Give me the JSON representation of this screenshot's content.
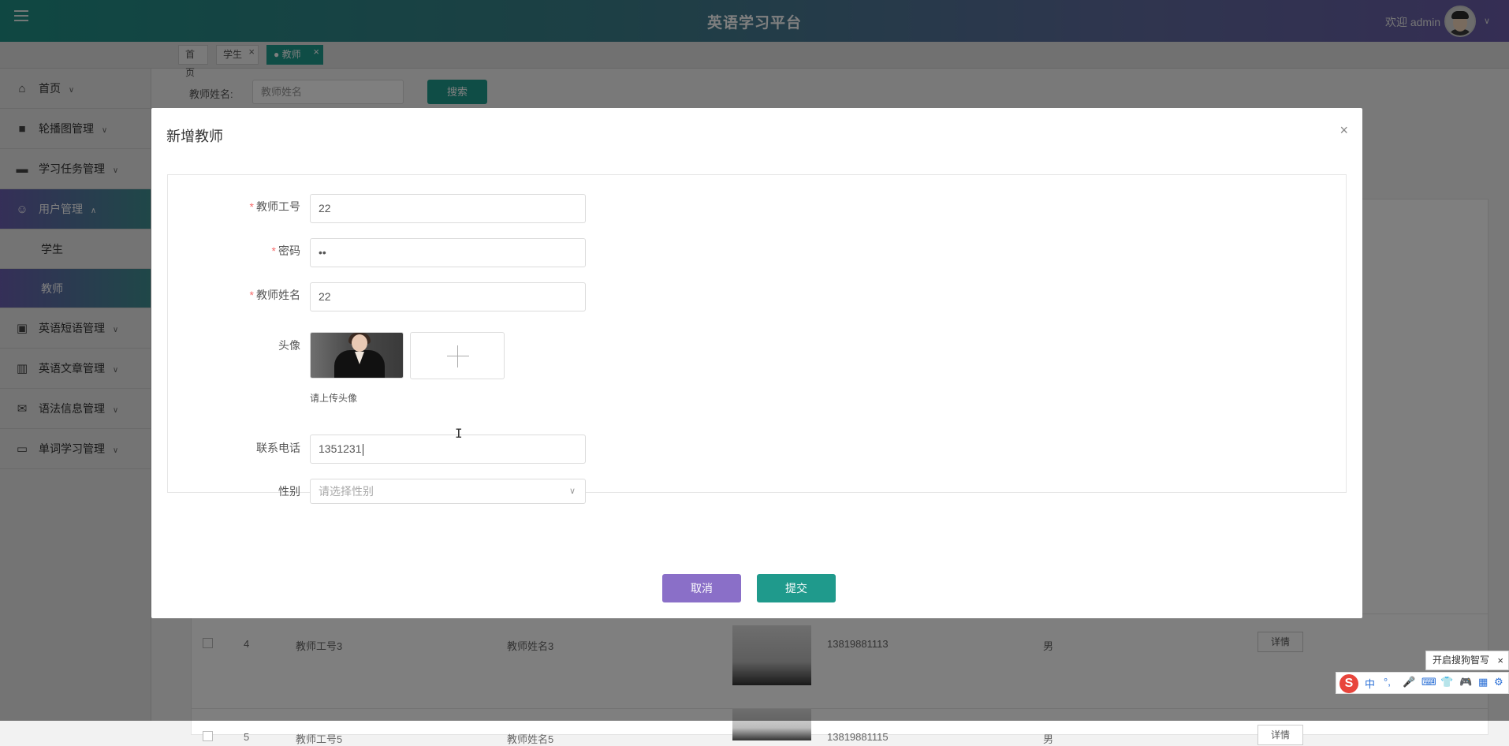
{
  "header": {
    "title": "英语学习平台",
    "welcome": "欢迎 admin",
    "menu_icon": "hamburger-icon",
    "user_caret": "∨"
  },
  "tabs": [
    {
      "label": "首页",
      "closable": false,
      "active": false
    },
    {
      "label": "学生",
      "closable": true,
      "active": false
    },
    {
      "label": "● 教师",
      "closable": true,
      "active": true
    }
  ],
  "tab_close_glyph": "×",
  "sidebar": {
    "items": [
      {
        "label": "首页",
        "icon": "home-icon",
        "glyph": "⌂",
        "caret": "∨"
      },
      {
        "label": "轮播图管理",
        "icon": "briefcase-icon",
        "glyph": "■",
        "caret": "∨"
      },
      {
        "label": "学习任务管理",
        "icon": "book-icon",
        "glyph": "▬",
        "caret": "∨"
      },
      {
        "label": "用户管理",
        "icon": "user-icon",
        "glyph": "☺",
        "caret": "∧",
        "open": true
      },
      {
        "label": "英语短语管理",
        "icon": "chip-icon",
        "glyph": "▣",
        "caret": "∨"
      },
      {
        "label": "英语文章管理",
        "icon": "columns-icon",
        "glyph": "▥",
        "caret": "∨"
      },
      {
        "label": "语法信息管理",
        "icon": "mail-icon",
        "glyph": "✉",
        "caret": "∨"
      },
      {
        "label": "单词学习管理",
        "icon": "wallet-icon",
        "glyph": "▭",
        "caret": "∨"
      }
    ],
    "sub_items": [
      {
        "label": "学生",
        "active": false
      },
      {
        "label": "教师",
        "active": true
      }
    ]
  },
  "search": {
    "label": "教师姓名:",
    "placeholder": "教师姓名",
    "button": "搜索"
  },
  "background_table": {
    "rows": [
      {
        "index": "4",
        "id": "教师工号3",
        "name": "教师姓名3",
        "phone": "13819881113",
        "gender": "男",
        "action": "详情"
      },
      {
        "index": "5",
        "id": "教师工号5",
        "name": "教师姓名5",
        "phone": "13819881115",
        "gender": "男",
        "action": "详情"
      }
    ]
  },
  "modal": {
    "title": "新增教师",
    "close_glyph": "×",
    "fields": {
      "teacher_id": {
        "label": "教师工号",
        "required": true,
        "value": "22"
      },
      "password": {
        "label": "密码",
        "required": true,
        "value": "••"
      },
      "teacher_name": {
        "label": "教师姓名",
        "required": true,
        "value": "22"
      },
      "avatar": {
        "label": "头像",
        "hint": "请上传头像"
      },
      "phone": {
        "label": "联系电话",
        "required": false,
        "value": "1351231"
      },
      "gender": {
        "label": "性别",
        "required": false,
        "placeholder": "请选择性别",
        "arrow": "∨"
      }
    },
    "required_mark": "*",
    "cancel_button": "取消",
    "submit_button": "提交"
  },
  "ime": {
    "tip": "开启搜狗智写",
    "tip_close": "×",
    "logo": "S",
    "mode": "中",
    "punct": "°,",
    "icons": [
      "mic-icon",
      "keyboard-icon",
      "skin-icon",
      "gamepad-icon",
      "grid-icon",
      "settings-icon"
    ]
  },
  "text_cursor_glyph": "I"
}
